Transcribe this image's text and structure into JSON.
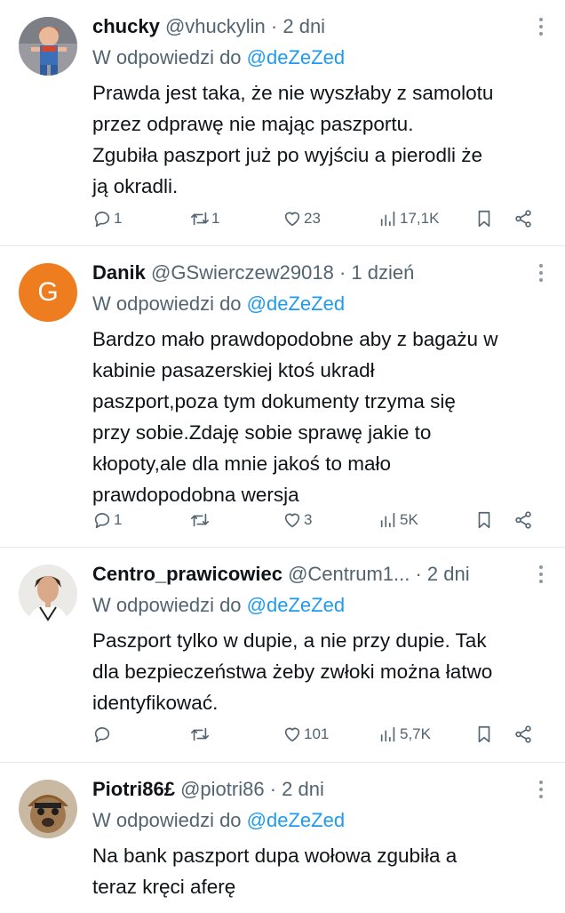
{
  "tweets": [
    {
      "name": "chucky",
      "handle": "@vhuckylin",
      "dot": "·",
      "time": "2 dni",
      "reply_prefix": "W odpowiedzi do",
      "reply_to": "@deZeZed",
      "text": "Prawda jest taka, że nie wyszłaby z samolotu\nprzez odprawę nie mając paszportu.\nZgubiła paszport już po wyjściu a pierodli że\nją okradli.",
      "replies": "1",
      "retweets": "1",
      "likes": "23",
      "views": "17,1K"
    },
    {
      "name": "Danik",
      "handle": "@GSwierczew29018",
      "dot": "·",
      "time": "1 dzień",
      "avatar_letter": "G",
      "reply_prefix": "W odpowiedzi do",
      "reply_to": "@deZeZed",
      "text": "Bardzo mało prawdopodobne aby z bagażu w\nkabinie pasazerskiej ktoś ukradł\npaszport,poza tym dokumenty trzyma się\nprzy sobie.Zdaję sobie sprawę jakie to\nkłopoty,ale dla mnie jakoś to mało\nprawdopodobna wersja",
      "replies": "1",
      "retweets": "",
      "likes": "3",
      "views": "5K"
    },
    {
      "name": "Centro_prawicowiec",
      "handle": "@Centrum1...",
      "dot": "·",
      "time": "2 dni",
      "reply_prefix": "W odpowiedzi do",
      "reply_to": "@deZeZed",
      "text": "Paszport tylko w dupie, a nie przy dupie. Tak\ndla bezpieczeństwa żeby zwłoki można łatwo\nidentyfikować.",
      "replies": "",
      "retweets": "",
      "likes": "101",
      "views": "5,7K"
    },
    {
      "name": "Piotri86£",
      "handle": "@piotri86",
      "dot": "·",
      "time": "2 dni",
      "reply_prefix": "W odpowiedzi do",
      "reply_to": "@deZeZed",
      "text": "Na bank paszport dupa wołowa zgubiła a\nteraz kręci aferę"
    }
  ],
  "icons": {
    "reply": "reply-icon",
    "retweet": "retweet-icon",
    "like": "heart-icon",
    "views": "views-icon",
    "bookmark": "bookmark-icon",
    "share": "share-icon",
    "more": "more-icon"
  }
}
